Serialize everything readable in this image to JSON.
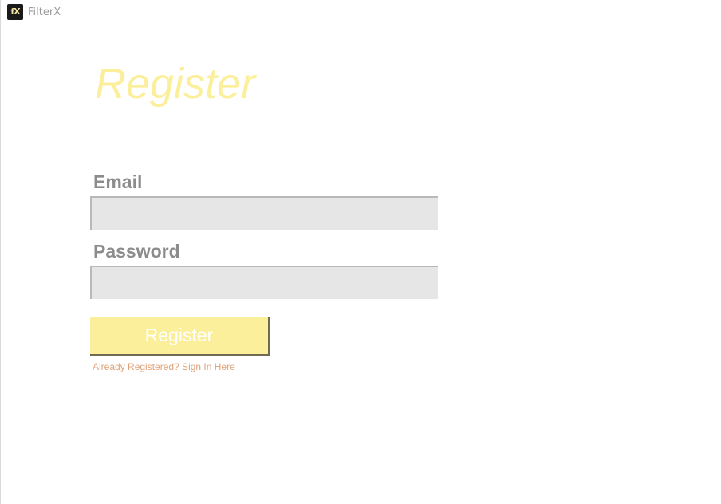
{
  "app": {
    "title": "FilterX",
    "icon_text": "fX",
    "icon_name": "filterx-logo-icon"
  },
  "colors": {
    "accent": "#fcef9b",
    "label": "#8c8c8c",
    "field_bg": "#e6e6e6",
    "link": "#e0a37a"
  },
  "form": {
    "title": "Register",
    "email_label": "Email",
    "email_value": "",
    "password_label": "Password",
    "password_value": "",
    "submit_label": "Register",
    "signin_link": "Already Registered? Sign In Here"
  }
}
